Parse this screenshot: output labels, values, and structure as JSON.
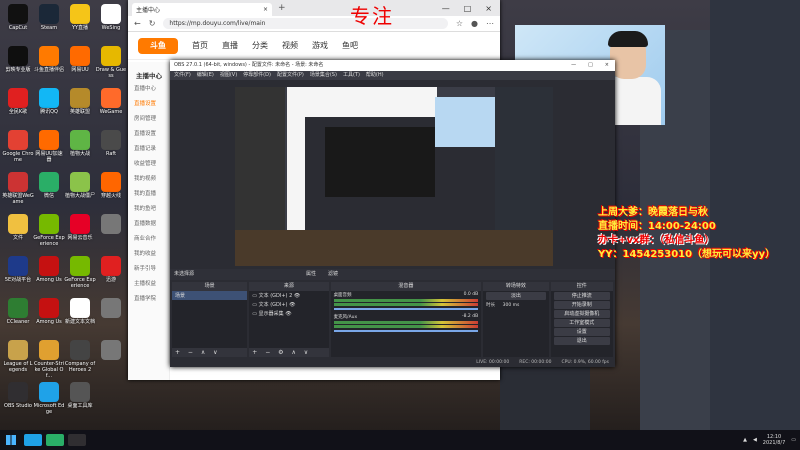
{
  "desktop": {
    "icons": [
      {
        "label": "CapCut",
        "color": "#111111"
      },
      {
        "label": "Steam",
        "color": "#1b2838"
      },
      {
        "label": "YY直播",
        "color": "#f5c518"
      },
      {
        "label": "WeSing",
        "color": "#ffffff"
      },
      {
        "label": "剪映专业版",
        "color": "#0f0f0f"
      },
      {
        "label": "斗鱼直播伴侣",
        "color": "#ff7a00"
      },
      {
        "label": "网易UU",
        "color": "#ff6a00"
      },
      {
        "label": "Draw & Guess",
        "color": "#e6b800"
      },
      {
        "label": "全民K歌",
        "color": "#e02020"
      },
      {
        "label": "腾讯QQ",
        "color": "#12b7f5"
      },
      {
        "label": "英雄联盟",
        "color": "#b58a2a"
      },
      {
        "label": "WeGame",
        "color": "#ff6a2a"
      },
      {
        "label": "Google Chrome",
        "color": "#e34133"
      },
      {
        "label": "网易UU加速器",
        "color": "#ff6a00"
      },
      {
        "label": "植物大战",
        "color": "#5fb545"
      },
      {
        "label": "Raft",
        "color": "#4a4a4a"
      },
      {
        "label": "英雄联盟WeGame",
        "color": "#c33"
      },
      {
        "label": "微信",
        "color": "#2aae67"
      },
      {
        "label": "植物大战僵尸",
        "color": "#8bc34a"
      },
      {
        "label": "穿越火线",
        "color": "#ff6600"
      },
      {
        "label": "文件",
        "color": "#f0c040"
      },
      {
        "label": "GeForce Experience",
        "color": "#76b900"
      },
      {
        "label": "网易云音乐",
        "color": "#e60026"
      },
      {
        "label": "",
        "color": "#777777"
      },
      {
        "label": "5E对战平台",
        "color": "#1e3a8a"
      },
      {
        "label": "Among Us",
        "color": "#c51111"
      },
      {
        "label": "GeForce Experience",
        "color": "#76b900"
      },
      {
        "label": "迅游",
        "color": "#e02020"
      },
      {
        "label": "CCleaner",
        "color": "#2e7d32"
      },
      {
        "label": "Among Us",
        "color": "#c51111"
      },
      {
        "label": "新建文本文档",
        "color": "#ffffff"
      },
      {
        "label": "",
        "color": "#777777"
      },
      {
        "label": "League of Legends",
        "color": "#c8a24b"
      },
      {
        "label": "Counter-Strike Global Of...",
        "color": "#e0a030"
      },
      {
        "label": "Company of Heroes 2",
        "color": "#444444"
      },
      {
        "label": "",
        "color": "#777777"
      },
      {
        "label": "OBS Studio",
        "color": "#302e31"
      },
      {
        "label": "Microsoft Edge",
        "color": "#1fa2e8"
      },
      {
        "label": "桌面工具库",
        "color": "#555555"
      }
    ]
  },
  "browser": {
    "tab_title": "主播中心",
    "url": "https://mp.douyu.com/live/main",
    "logo": "斗鱼",
    "nav": [
      "首页",
      "直播",
      "分类",
      "视频",
      "游戏",
      "鱼吧"
    ],
    "sidebar_title": "主播中心",
    "sidebar_items": [
      "直播中心",
      "直播设置",
      "房间管理",
      "直播设置",
      "直播记录",
      "收益管理",
      "我的视频",
      "我的直播",
      "我的鱼吧",
      "直播数据",
      "商业合作",
      "我的收益",
      "新手引导",
      "主播权益",
      "直播学院"
    ]
  },
  "obs": {
    "title": "OBS 27.0.1 (64-bit, windows) - 配置文件: 未命名 - 场景: 未命名",
    "menu": [
      "文件(F)",
      "编辑(E)",
      "视图(V)",
      "停靠部件(D)",
      "配置文件(P)",
      "场景集合(S)",
      "工具(T)",
      "帮助(H)"
    ],
    "toolbar": [
      "未选择源",
      "属性",
      "滤镜"
    ],
    "docks": {
      "scenes": {
        "header": "场景",
        "items": [
          "场景"
        ]
      },
      "sources": {
        "header": "来源",
        "items": [
          "文本 (GDI+) 2",
          "文本 (GDI+)",
          "显示器采集"
        ]
      },
      "mixer": {
        "header": "混音器",
        "tracks": [
          {
            "name": "桌面音频",
            "level": "0.0 dB"
          },
          {
            "name": "麦克风/Aux",
            "level": "-8.2 dB"
          }
        ]
      },
      "transitions": {
        "header": "转场特效",
        "type": "淡出",
        "duration_label": "时长",
        "duration": "300 ms"
      },
      "controls": {
        "header": "控件",
        "buttons": [
          "停止推流",
          "开始录制",
          "启动虚拟摄像机",
          "工作室模式",
          "设置",
          "退出"
        ]
      }
    },
    "status": [
      "LIVE: 00:00:00",
      "REC: 00:00:00",
      "CPU: 0.9%, 60.00 fps"
    ]
  },
  "overlay": {
    "focus": "专注",
    "promo_lines": [
      {
        "text": "上周大爹：晚霞落日与秋",
        "style": "p1"
      },
      {
        "text": "直播时间：14:00-24:00",
        "style": "p1"
      },
      {
        "text": "办卡+vx群：（私信斗鱼）",
        "style": "p2"
      },
      {
        "text": "YY：1454253010（想玩可以来yy）",
        "style": "p1"
      }
    ]
  },
  "taskbar": {
    "time": "12:10",
    "date": "2021/8/7",
    "apps": [
      "#1fa2e8",
      "#2aae67",
      "#302e31"
    ]
  }
}
